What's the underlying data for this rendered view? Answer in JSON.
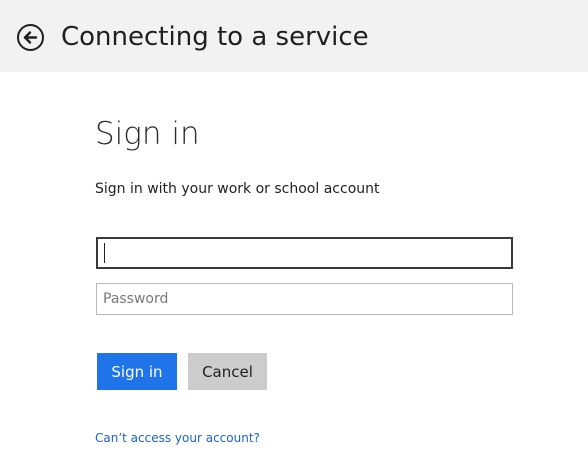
{
  "header": {
    "title": "Connecting to a service",
    "back_icon": "back-arrow-icon"
  },
  "form": {
    "heading": "Sign in",
    "instruction": "Sign in with your work or school account",
    "username": {
      "value": "",
      "placeholder": ""
    },
    "password": {
      "value": "",
      "placeholder": "Password"
    },
    "signin_label": "Sign in",
    "cancel_label": "Cancel",
    "help_link": "Can’t access your account?"
  },
  "colors": {
    "accent": "#1e74e8",
    "link": "#1a64c4",
    "header_bg": "#f2f2f2",
    "cancel_bg": "#cccccc"
  }
}
